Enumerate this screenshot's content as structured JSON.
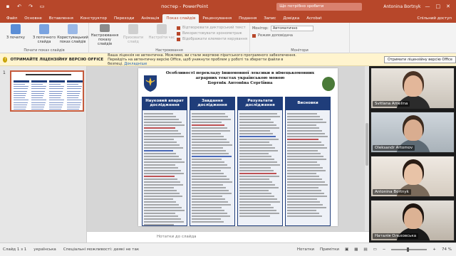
{
  "titlebar": {
    "title": "постер - PowerPoint",
    "search_placeholder": "Що потрібно зробити",
    "user": "Antonina Bortnyk"
  },
  "tabs": [
    "Файл",
    "Основне",
    "Вставлення",
    "Конструктор",
    "Переходи",
    "Анімація",
    "Показ слайдів",
    "Рецензування",
    "Подання",
    "Запис",
    "Довідка",
    "Acrobat"
  ],
  "active_tab": "Показ слайдів",
  "share_label": "Спільний доступ",
  "ribbon": {
    "start_group_label": "Почати показ слайдів",
    "start_buttons": [
      "З початку",
      "З поточного слайда",
      "Користувацький показ слайдів"
    ],
    "setup_group_label": "Настроювання",
    "setup_buttons": [
      "Настроювання показу слайдів",
      "Приховати слайд",
      "Настроїти час"
    ],
    "setup_options": [
      "Відтворювати дикторський текст",
      "Використовувати хронометраж",
      "Відображати елементи керування"
    ],
    "monitor_group_label": "Монітори",
    "monitor_label": "Монітор:",
    "monitor_value": "Автоматично",
    "presenter_view_label": "Режим доповідача"
  },
  "infobar": {
    "heading": "ОТРИМАЙТЕ ЛІЦЕНЗІЙНУ ВЕРСІЮ OFFICE",
    "message": "Ваша ліцензія не автентична. Можливо, ви стали жертвою піратського програмного забезпечення. Перейдіть на автентичну версію Office, щоб уникнути проблем у роботі та зберегти файли в безпеці.",
    "link": "Докладніше",
    "button": "Отримати ліцензійну версію Office"
  },
  "thumbnail": {
    "number": "1"
  },
  "slide": {
    "title": "Особливості перекладу іншомовної лексики в німецькомовних аграрних текстах українською мовою",
    "author": "Бортнік Антоніна Сергіївна",
    "columns": [
      {
        "heading": "Науковий апарат дослідження"
      },
      {
        "heading": "Завдання дослідження"
      },
      {
        "heading": "Результати дослідження"
      },
      {
        "heading": "Висновки"
      }
    ]
  },
  "notes_placeholder": "Нотатки до слайда",
  "participants": [
    {
      "name": "Svitlana Amelina"
    },
    {
      "name": "Oleksandr Artomov"
    },
    {
      "name": "Antonina Bortnyk"
    },
    {
      "name": "Наталія Ольховська"
    }
  ],
  "statusbar": {
    "slide_info": "Слайд 1 з 1",
    "language": "українська",
    "accessibility": "Спеціальні можливості: деякі не так",
    "notes_btn": "Нотатки",
    "comments_btn": "Примітки",
    "zoom": "74 %"
  },
  "colors": {
    "accent": "#b7472a",
    "column_header": "#1f3d7a",
    "infobar": "#fff4ce"
  }
}
